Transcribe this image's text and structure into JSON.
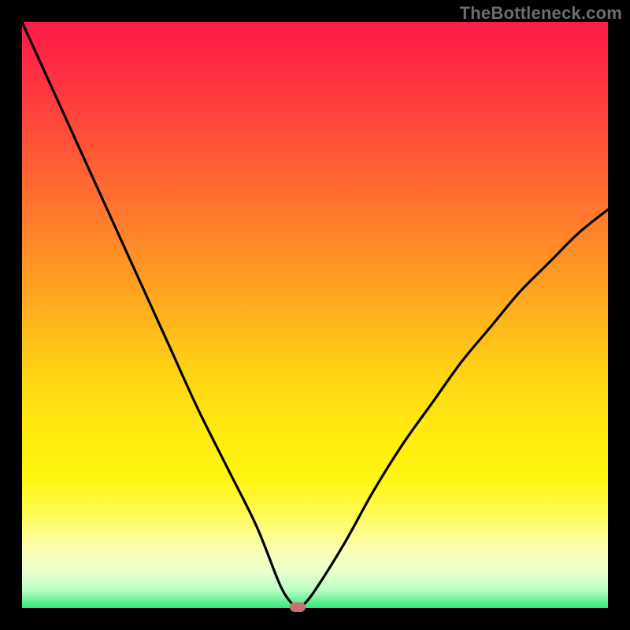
{
  "watermark": "TheBottleneck.com",
  "colors": {
    "frame": "#000000",
    "curve": "#000000",
    "marker": "#cc6e72"
  },
  "chart_data": {
    "type": "line",
    "title": "",
    "xlabel": "",
    "ylabel": "",
    "xlim": [
      0,
      100
    ],
    "ylim": [
      0,
      100
    ],
    "grid": false,
    "legend": false,
    "series": [
      {
        "name": "bottleneck-curve",
        "x": [
          0,
          5,
          10,
          15,
          20,
          25,
          30,
          35,
          40,
          44,
          46,
          47,
          48,
          50,
          55,
          60,
          65,
          70,
          75,
          80,
          85,
          90,
          95,
          100
        ],
        "y": [
          100,
          89,
          78,
          67,
          56,
          45,
          34,
          24,
          14,
          4,
          0.8,
          0,
          0.5,
          3,
          11,
          20,
          28,
          35,
          42,
          48,
          54,
          59,
          64,
          68
        ]
      }
    ],
    "marker": {
      "x": 47,
      "y": 0
    },
    "gradient_stops": [
      {
        "pos": 0,
        "color": "#ff1a47"
      },
      {
        "pos": 50,
        "color": "#ffb21e"
      },
      {
        "pos": 78,
        "color": "#fff60f"
      },
      {
        "pos": 100,
        "color": "#32e77a"
      }
    ]
  }
}
